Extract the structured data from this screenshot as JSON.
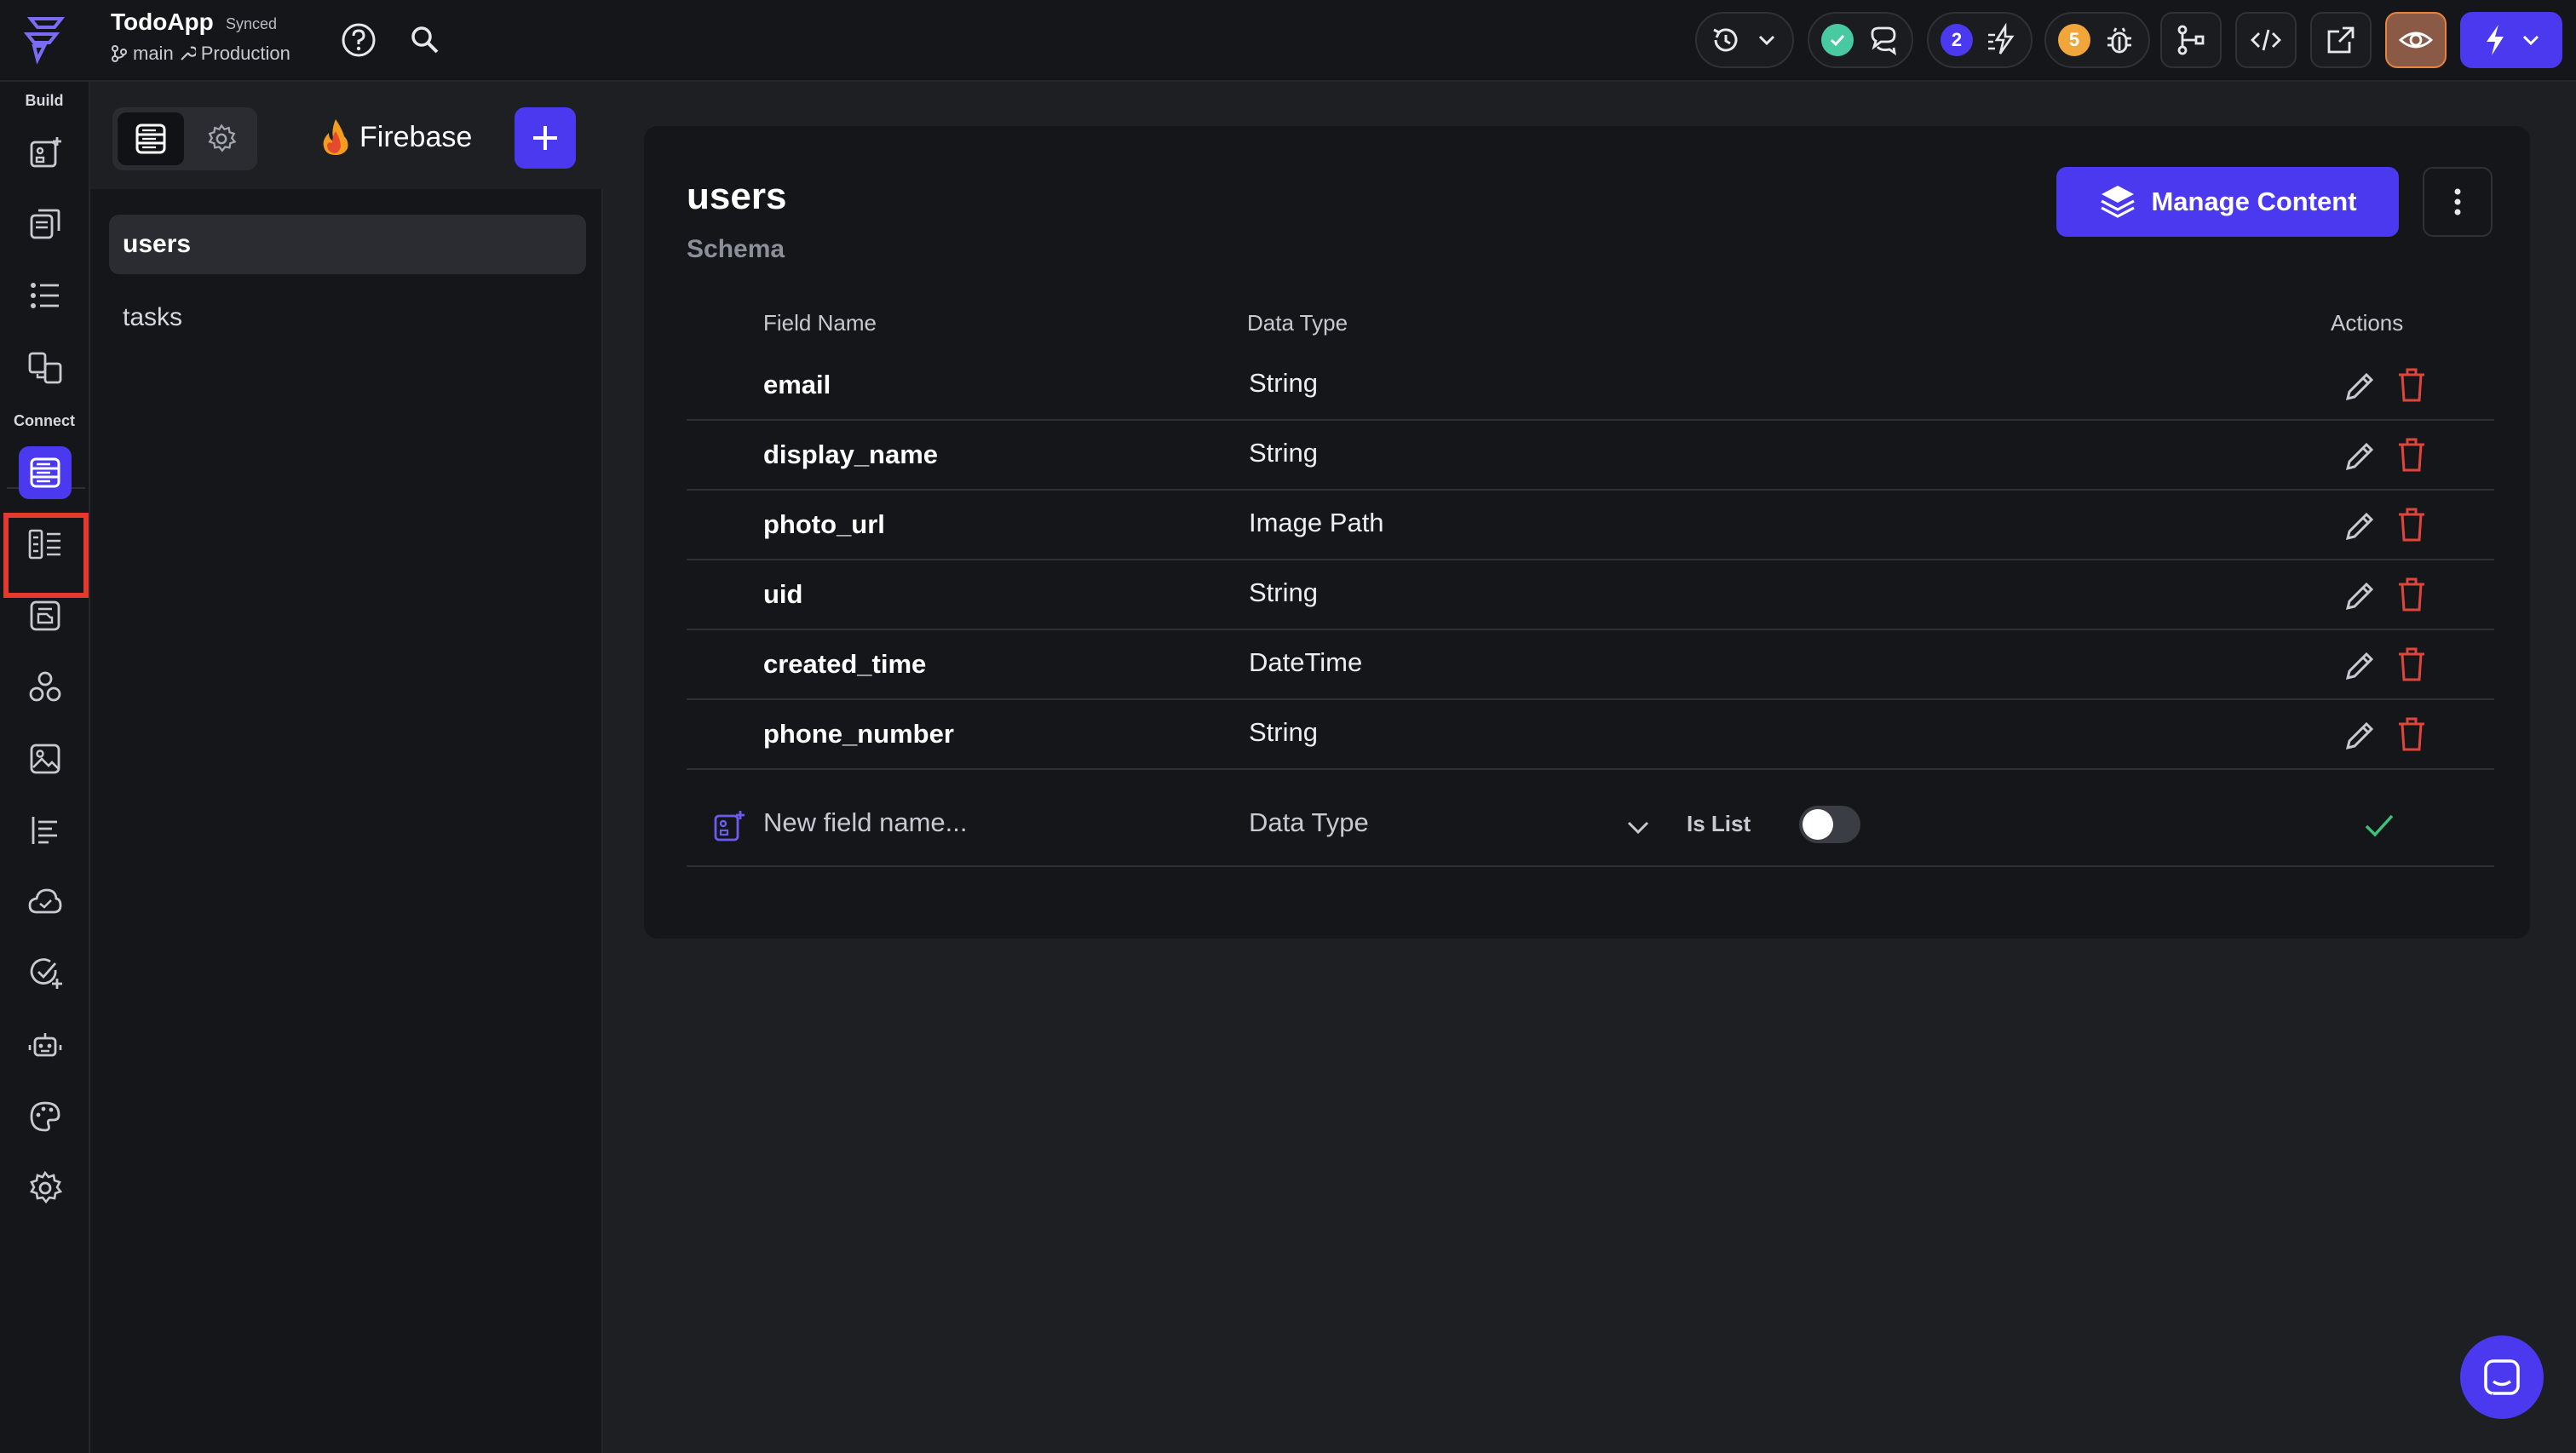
{
  "app": {
    "name": "TodoApp",
    "sync_status": "Synced",
    "branch": "main",
    "environment": "Production"
  },
  "toolbar": {
    "comments_badge": "2",
    "issues_badge": "5"
  },
  "rail": {
    "build_label": "Build",
    "connect_label": "Connect"
  },
  "panel": {
    "provider": "Firebase",
    "collections": [
      "users",
      "tasks"
    ],
    "selected_collection": "users"
  },
  "schema": {
    "collection_title": "users",
    "subtitle": "Schema",
    "manage_button": "Manage Content",
    "headers": {
      "field_name": "Field Name",
      "data_type": "Data Type",
      "actions": "Actions"
    },
    "fields": [
      {
        "name": "email",
        "type": "String"
      },
      {
        "name": "display_name",
        "type": "String"
      },
      {
        "name": "photo_url",
        "type": "Image Path"
      },
      {
        "name": "uid",
        "type": "String"
      },
      {
        "name": "created_time",
        "type": "DateTime"
      },
      {
        "name": "phone_number",
        "type": "String"
      }
    ],
    "new_field": {
      "placeholder": "New field name...",
      "type_placeholder": "Data Type",
      "is_list_label": "Is List",
      "is_list": false
    }
  },
  "colors": {
    "accent": "#4b39ef",
    "delete": "#e0453b",
    "confirm": "#39c47a",
    "highlight": "#e53a2b"
  }
}
